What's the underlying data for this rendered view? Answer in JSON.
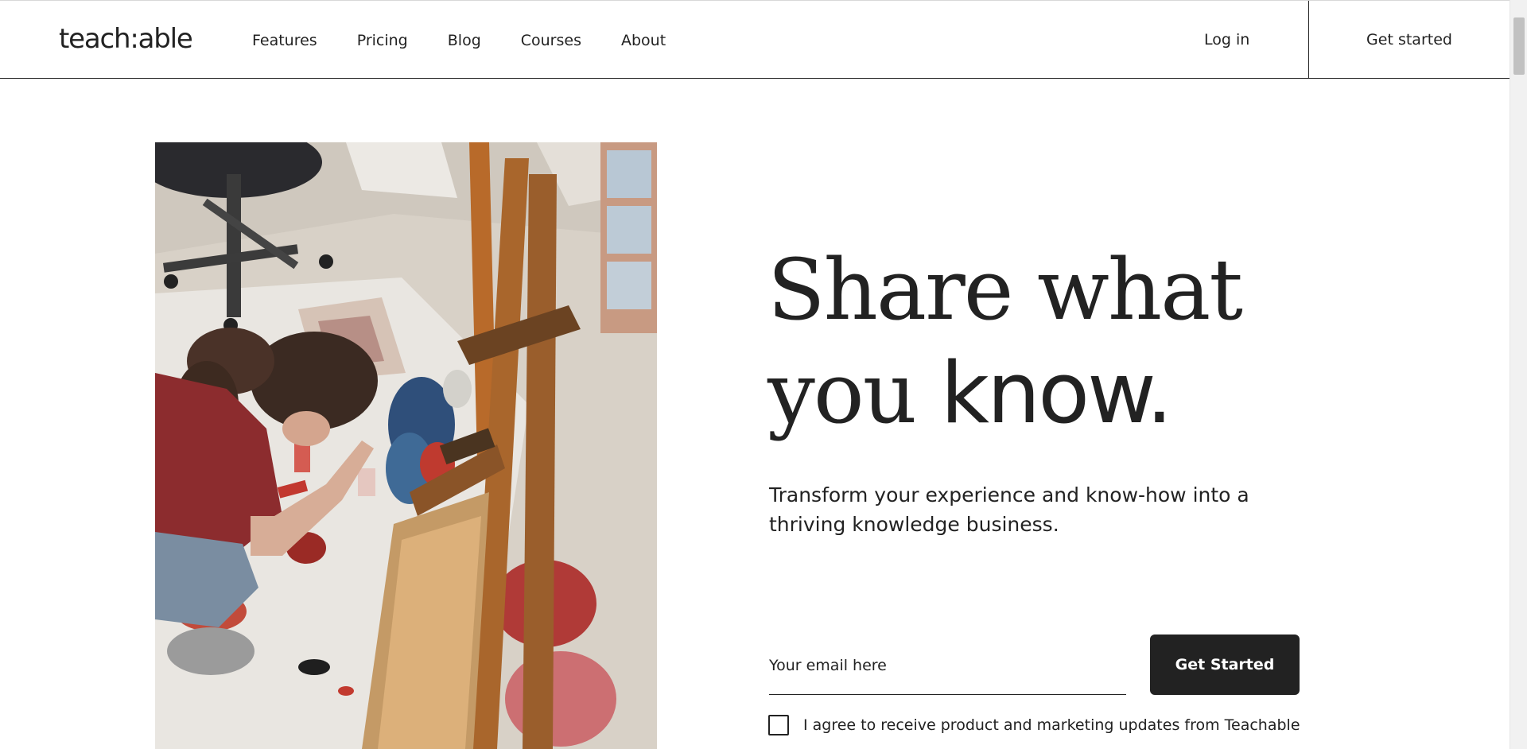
{
  "header": {
    "logo": "teach:able",
    "nav": [
      {
        "label": "Features"
      },
      {
        "label": "Pricing"
      },
      {
        "label": "Blog"
      },
      {
        "label": "Courses"
      },
      {
        "label": "About"
      }
    ],
    "login_label": "Log in",
    "get_started_label": "Get started"
  },
  "hero": {
    "title_line1": "Share what",
    "title_line2_serif": "you ",
    "title_line2_sans": "know.",
    "subtitle": "Transform your experience and know-how into a thriving knowledge business.",
    "email_placeholder": "Your email here",
    "cta_label": "Get Started",
    "consent_label": "I agree to receive product and marketing updates from Teachable",
    "image_description": "artist-painting-photo"
  },
  "colors": {
    "text": "#222222",
    "background": "#ffffff",
    "button": "#222222",
    "button_text": "#ffffff"
  }
}
